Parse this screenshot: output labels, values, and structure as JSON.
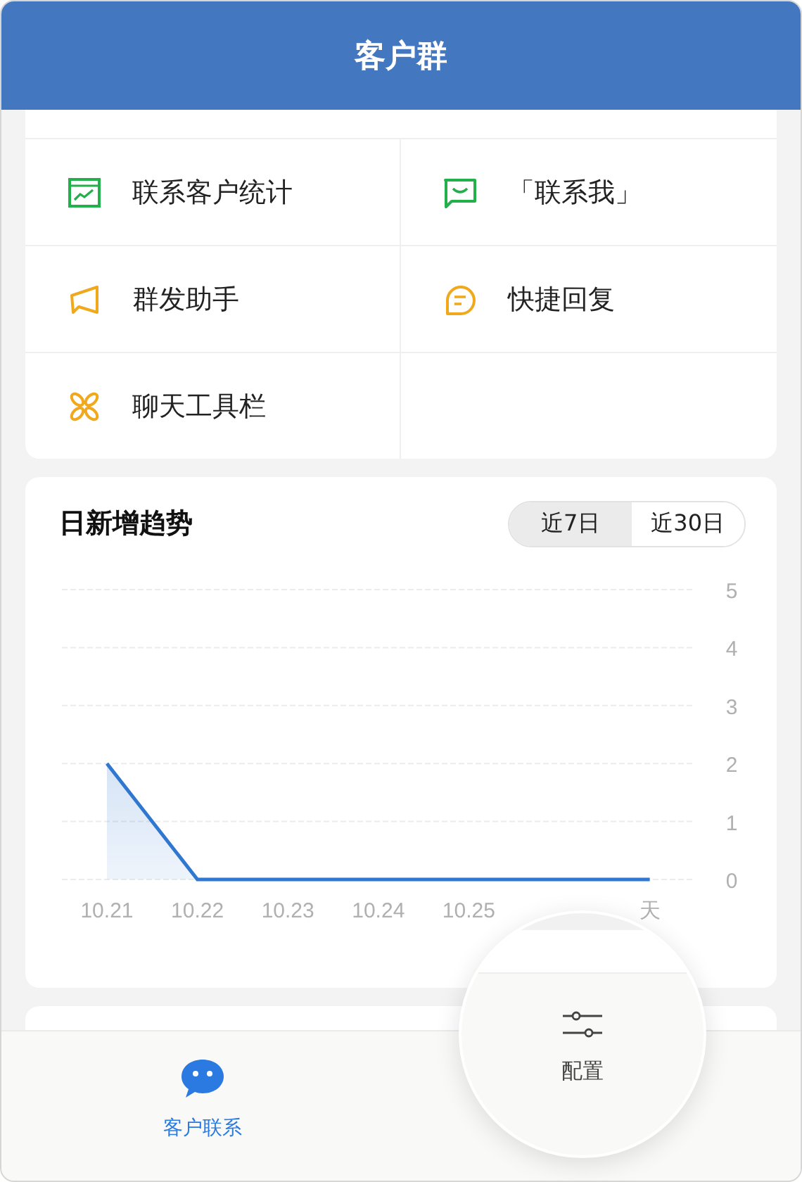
{
  "header": {
    "title": "客户群"
  },
  "tools": [
    {
      "label": "联系客户统计",
      "kind": "chart",
      "color": "#22b04b"
    },
    {
      "label": "「联系我」",
      "kind": "message",
      "color": "#22b04b"
    },
    {
      "label": "群发助手",
      "kind": "megaphone",
      "color": "#f0a81c"
    },
    {
      "label": "快捷回复",
      "kind": "reply",
      "color": "#f0a81c"
    },
    {
      "label": "聊天工具栏",
      "kind": "toolbar",
      "color": "#f0a81c"
    }
  ],
  "trend": {
    "title": "日新增趋势",
    "ranges": [
      {
        "label": "近7日",
        "selected": true
      },
      {
        "label": "近30日",
        "selected": false
      }
    ],
    "chart_data": {
      "type": "area",
      "categories": [
        "10.21",
        "10.22",
        "10.23",
        "10.24",
        "10.25",
        null,
        "天"
      ],
      "series": [
        {
          "color": "#2f77d0",
          "values": [
            2,
            0,
            0,
            0,
            0,
            0,
            0
          ]
        }
      ],
      "ylim": [
        0,
        5
      ],
      "yticks": [
        0,
        1,
        2,
        3,
        4,
        5
      ],
      "grid": true
    }
  },
  "bottom_tabs": [
    {
      "label": "客户联系",
      "kind": "chat",
      "selected": true
    },
    {
      "label": "配置",
      "kind": "settings",
      "selected": false
    }
  ]
}
